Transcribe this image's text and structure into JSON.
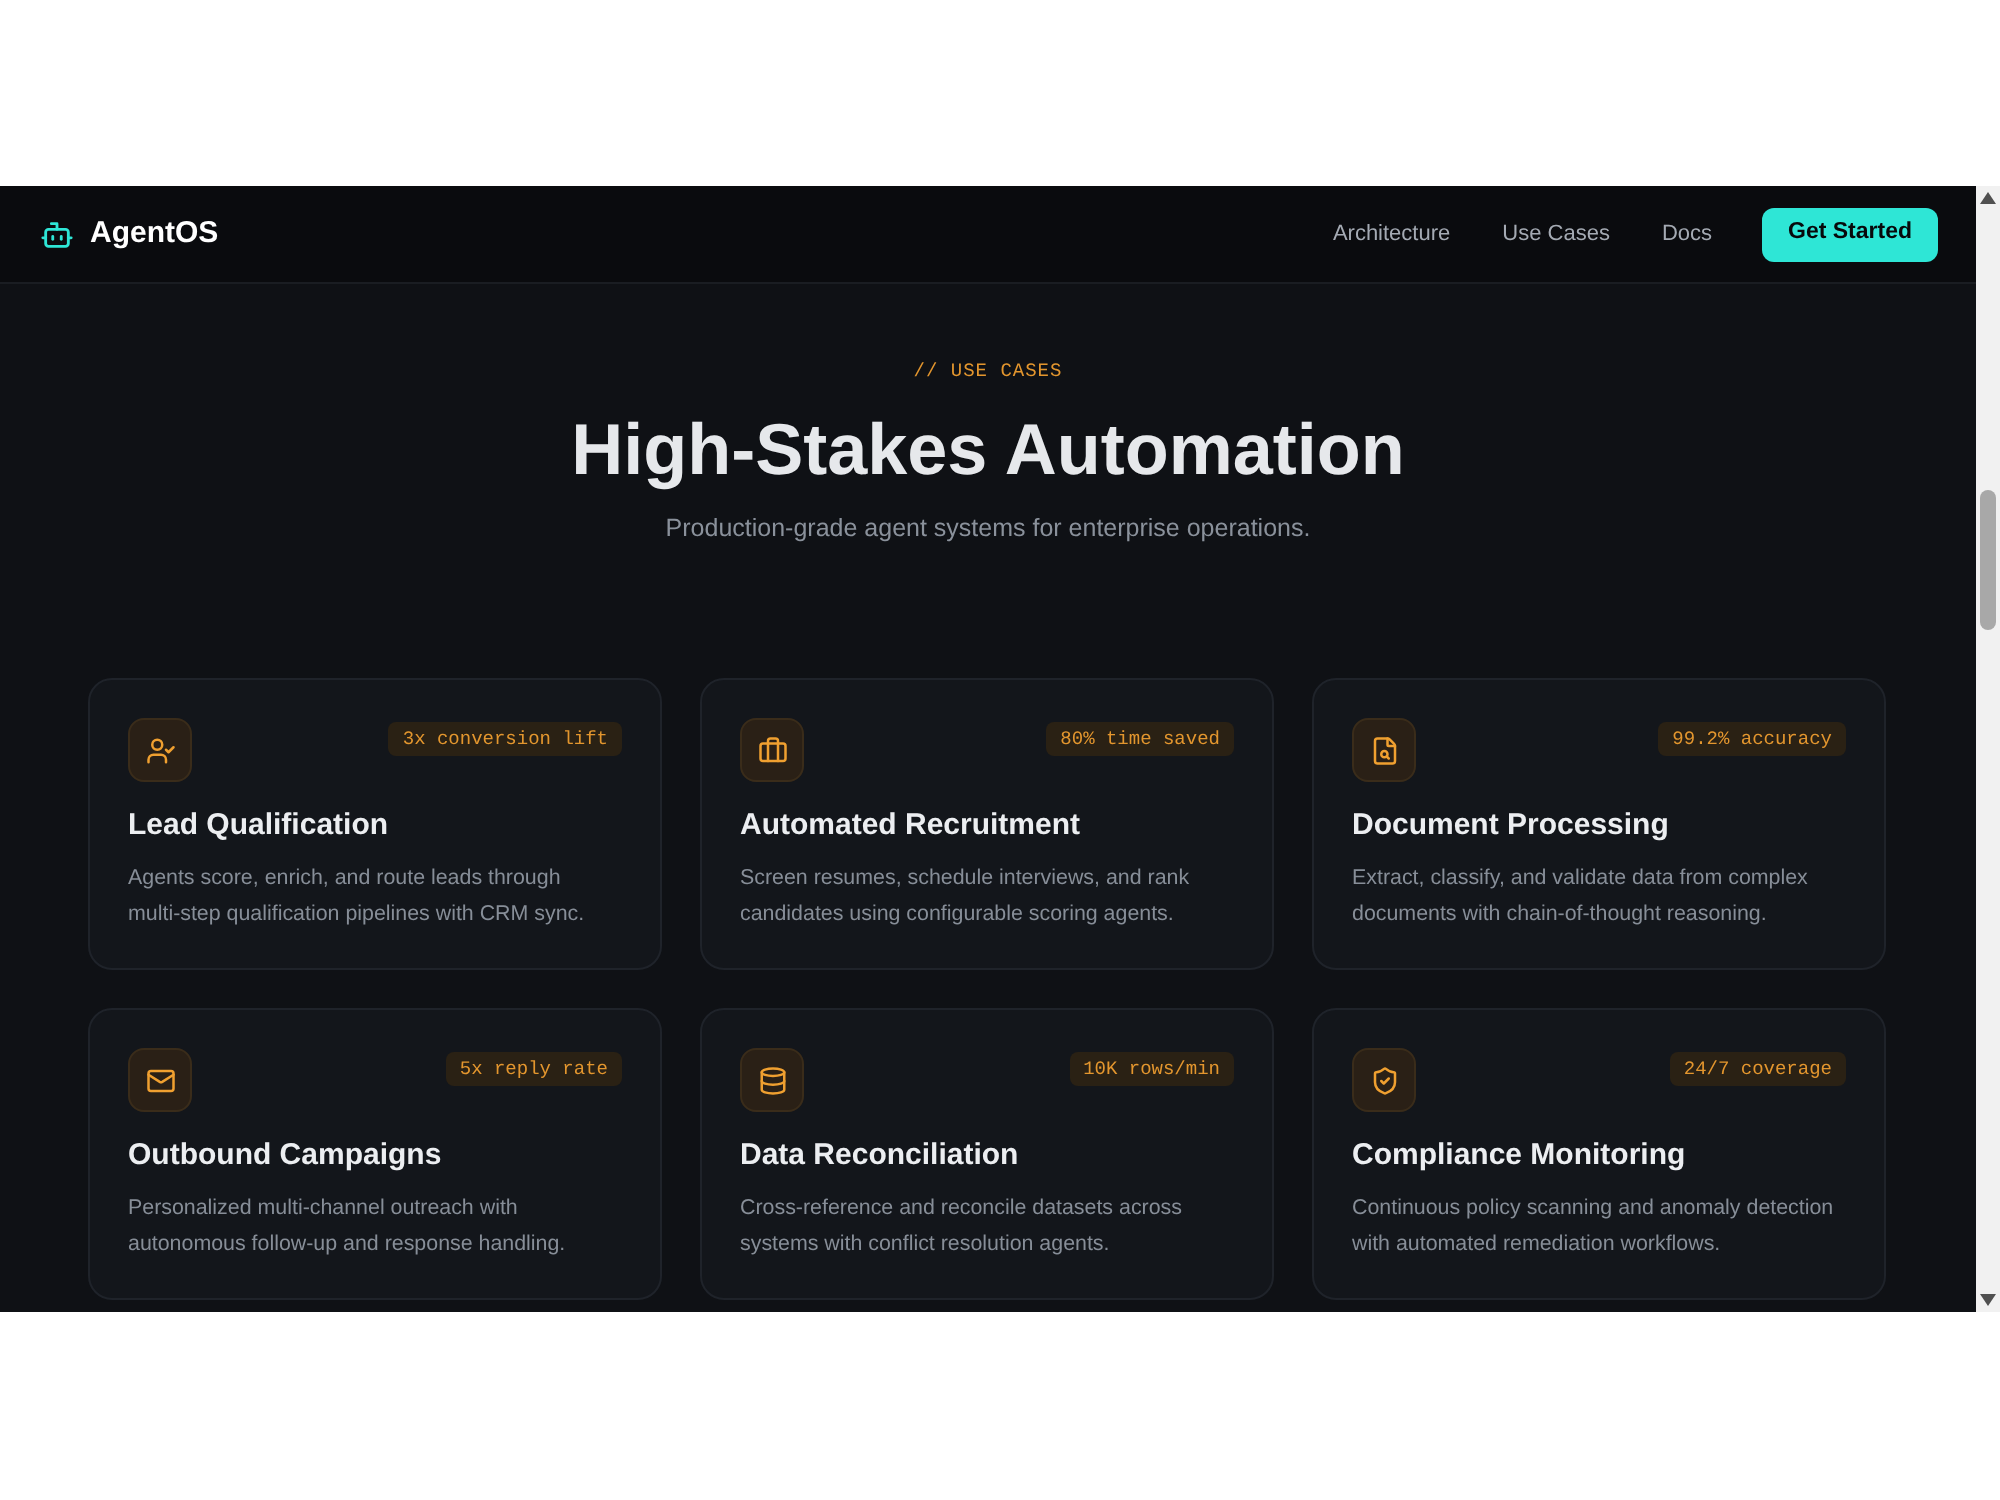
{
  "nav": {
    "logo": "AgentOS",
    "links": [
      "Architecture",
      "Use Cases",
      "Docs"
    ],
    "cta": "Get Started"
  },
  "section": {
    "eyebrow": "// USE CASES",
    "title": "High-Stakes Automation",
    "subtitle": "Production-grade agent systems for enterprise operations."
  },
  "cards": [
    {
      "kind": "user-check",
      "title": "Lead Qualification",
      "badge": "3x conversion lift",
      "description": "Agents score, enrich, and route leads through multi-step qualification pipelines with CRM sync."
    },
    {
      "kind": "briefcase",
      "title": "Automated Recruitment",
      "badge": "80% time saved",
      "description": "Screen resumes, schedule interviews, and rank candidates using configurable scoring agents."
    },
    {
      "kind": "file-search",
      "title": "Document Processing",
      "badge": "99.2% accuracy",
      "description": "Extract, classify, and validate data from complex documents with chain-of-thought reasoning."
    },
    {
      "kind": "mail",
      "title": "Outbound Campaigns",
      "badge": "5x reply rate",
      "description": "Personalized multi-channel outreach with autonomous follow-up and response handling."
    },
    {
      "kind": "database",
      "title": "Data Reconciliation",
      "badge": "10K rows/min",
      "description": "Cross-reference and reconcile datasets across systems with conflict resolution agents."
    },
    {
      "kind": "shield-check",
      "title": "Compliance Monitoring",
      "badge": "24/7 coverage",
      "description": "Continuous policy scanning and anomaly detection with automated remediation workflows."
    }
  ]
}
